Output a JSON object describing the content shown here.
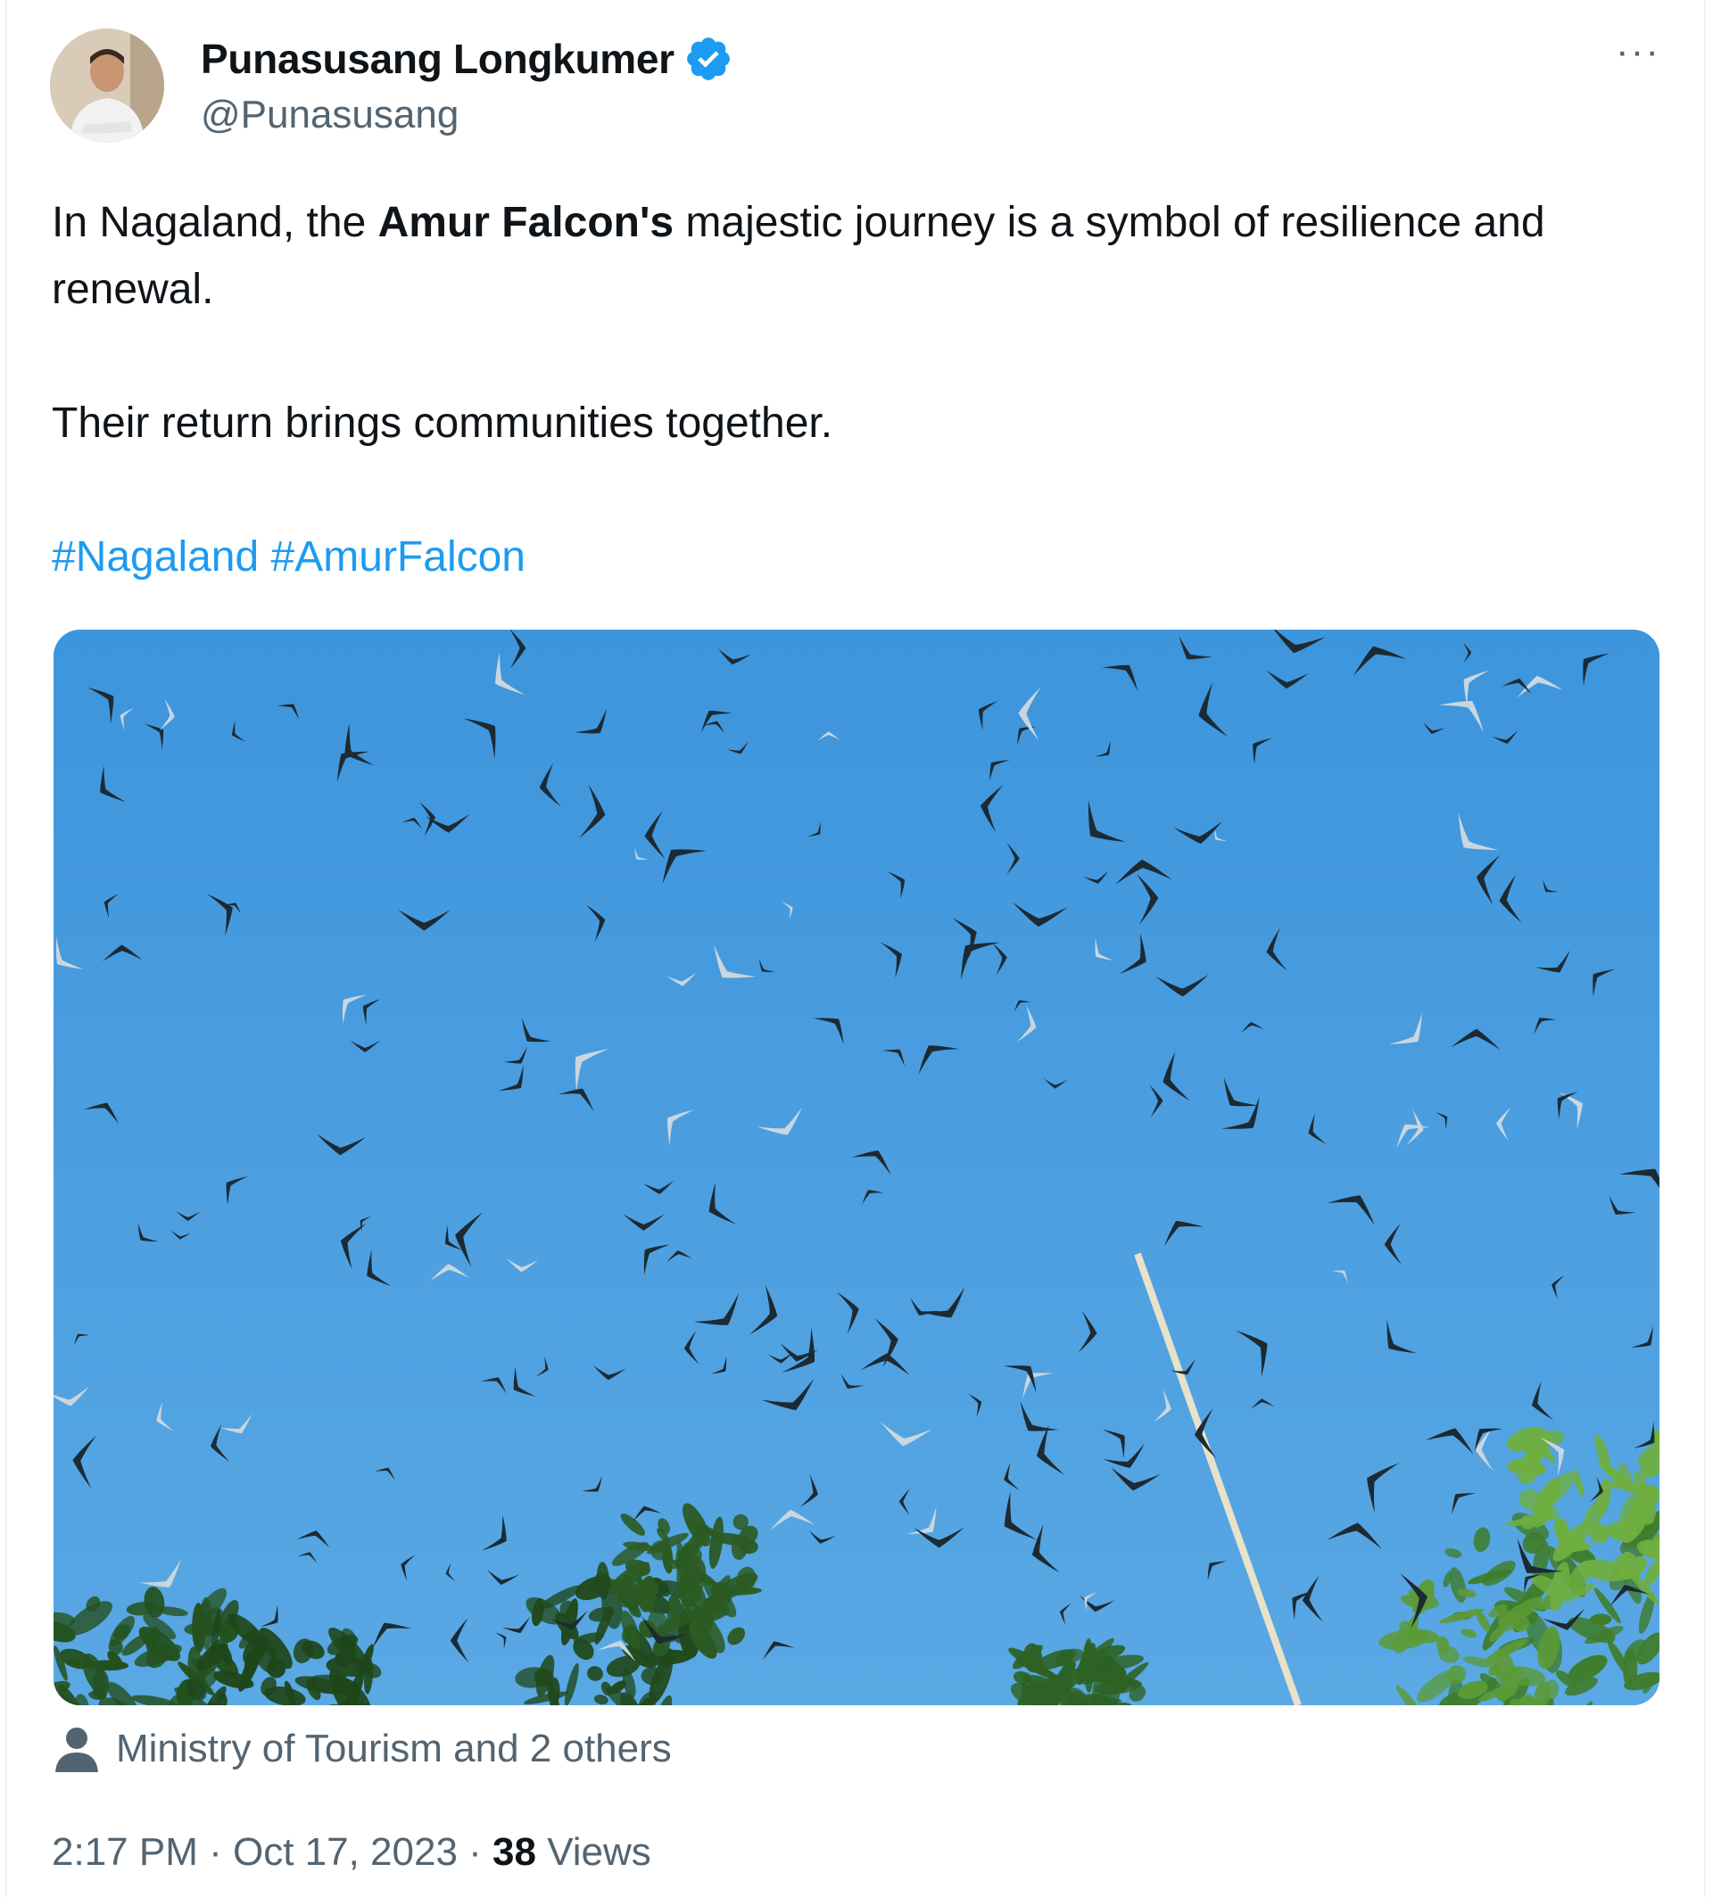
{
  "author": {
    "display_name": "Punasusang Longkumer",
    "handle": "@Punasusang",
    "verified_icon": "verified-badge-icon",
    "avatar_icon": "avatar"
  },
  "more_menu": {
    "label": "···",
    "icon": "more-icon"
  },
  "tweet": {
    "line1_before": "In Nagaland, the ",
    "line1_bold": "Amur Falcon's",
    "line1_after": " majestic journey is a symbol of resilience and renewal.",
    "line2": "Their return brings communities together.",
    "hashtags": [
      "#Nagaland",
      "#AmurFalcon"
    ]
  },
  "media": {
    "description_icon": "photo-amur-falcons-flock",
    "sky_color": "#4ea1e0",
    "leaf_color": "#2f6b2a"
  },
  "tagged": {
    "icon": "person-icon",
    "text": "Ministry of Tourism and 2 others"
  },
  "meta": {
    "time": "2:17 PM",
    "sep1": " · ",
    "date": "Oct 17, 2023",
    "sep2": " · ",
    "views_count": "38",
    "views_label": " Views"
  },
  "colors": {
    "accent": "#1d9bf0",
    "muted": "#536471",
    "text": "#0f1419"
  }
}
